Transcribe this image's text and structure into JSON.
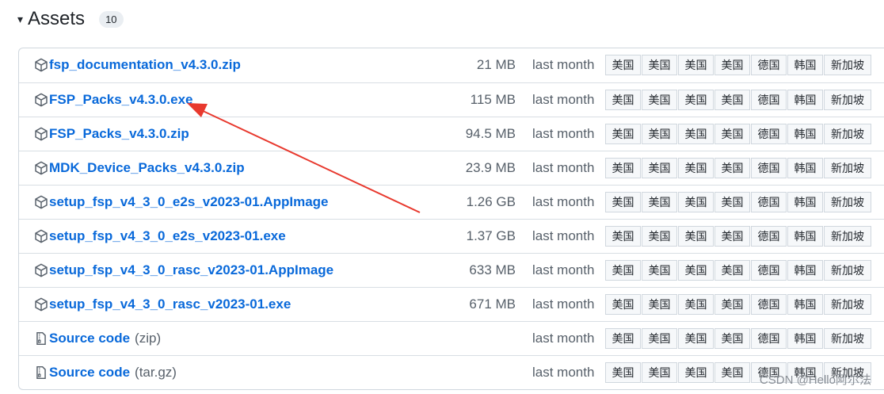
{
  "header": {
    "caret": "▾",
    "title": "Assets",
    "count": "10"
  },
  "mirrors": [
    "美国",
    "美国",
    "美国",
    "美国",
    "德国",
    "韩国",
    "新加坡"
  ],
  "assets": [
    {
      "name": "fsp_documentation_v4.3.0.zip",
      "suffix": "",
      "size": "21 MB",
      "date": "last month",
      "icon": "package-icon"
    },
    {
      "name": "FSP_Packs_v4.3.0.exe",
      "suffix": "",
      "size": "115 MB",
      "date": "last month",
      "icon": "package-icon"
    },
    {
      "name": "FSP_Packs_v4.3.0.zip",
      "suffix": "",
      "size": "94.5 MB",
      "date": "last month",
      "icon": "package-icon"
    },
    {
      "name": "MDK_Device_Packs_v4.3.0.zip",
      "suffix": "",
      "size": "23.9 MB",
      "date": "last month",
      "icon": "package-icon"
    },
    {
      "name": "setup_fsp_v4_3_0_e2s_v2023-01.AppImage",
      "suffix": "",
      "size": "1.26 GB",
      "date": "last month",
      "icon": "package-icon"
    },
    {
      "name": "setup_fsp_v4_3_0_e2s_v2023-01.exe",
      "suffix": "",
      "size": "1.37 GB",
      "date": "last month",
      "icon": "package-icon"
    },
    {
      "name": "setup_fsp_v4_3_0_rasc_v2023-01.AppImage",
      "suffix": "",
      "size": "633 MB",
      "date": "last month",
      "icon": "package-icon"
    },
    {
      "name": "setup_fsp_v4_3_0_rasc_v2023-01.exe",
      "suffix": "",
      "size": "671 MB",
      "date": "last month",
      "icon": "package-icon"
    },
    {
      "name": "Source code",
      "suffix": "(zip)",
      "size": "",
      "date": "last month",
      "icon": "file-zip-icon"
    },
    {
      "name": "Source code",
      "suffix": "(tar.gz)",
      "size": "",
      "date": "last month",
      "icon": "file-zip-icon"
    }
  ],
  "watermark": "CSDN @Hello阿尔法",
  "colors": {
    "link": "#0969da",
    "arrow": "#e8392e",
    "border": "#d0d7de"
  }
}
